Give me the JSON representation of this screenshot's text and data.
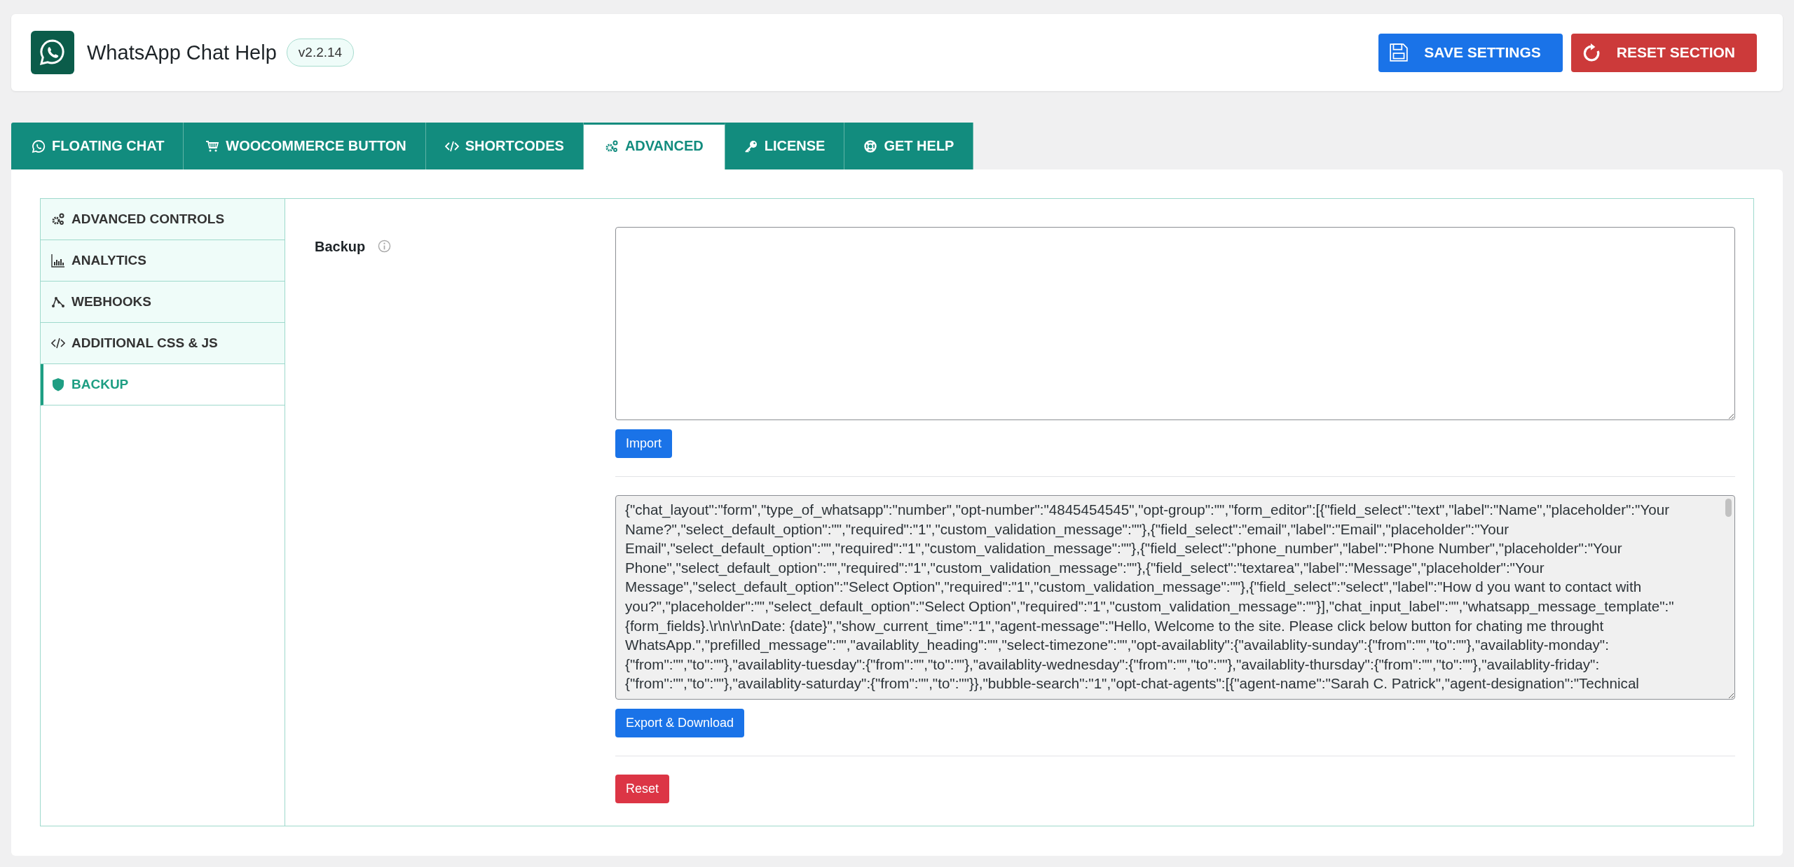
{
  "header": {
    "title": "WhatsApp Chat Help",
    "version": "v2.2.14",
    "buttons": [
      {
        "label": "SAVE SETTINGS",
        "kind": "save"
      },
      {
        "label": "RESET SECTION",
        "kind": "reset"
      }
    ]
  },
  "tabs": [
    {
      "label": "FLOATING CHAT",
      "selected": false
    },
    {
      "label": "WOOCOMMERCE BUTTON",
      "selected": false
    },
    {
      "label": "SHORTCODES",
      "selected": false
    },
    {
      "label": "ADVANCED",
      "selected": true
    },
    {
      "label": "LICENSE",
      "selected": false
    },
    {
      "label": "GET HELP",
      "selected": false
    }
  ],
  "sidebar": {
    "items": [
      {
        "label": "ADVANCED CONTROLS",
        "selected": false
      },
      {
        "label": "ANALYTICS",
        "selected": false
      },
      {
        "label": "WEBHOOKS",
        "selected": false
      },
      {
        "label": "ADDITIONAL CSS & JS",
        "selected": false
      },
      {
        "label": "BACKUP",
        "selected": true
      }
    ]
  },
  "backup": {
    "label": "Backup",
    "import_button": "Import",
    "export_lines": [
      "{\"chat_layout\":\"form\",\"type_of_whatsapp\":\"number\",\"opt-number\":\"4845454545\",\"opt-group\":\"\",\"form_editor\":[{\"field_select\":\"text\",\"label\":\"Name\",\"placeholder\":\"Your",
      "Name?\",\"select_default_option\":\"\",\"required\":\"1\",\"custom_validation_message\":\"\"},{\"field_select\":\"email\",\"label\":\"Email\",\"placeholder\":\"Your",
      "Email\",\"select_default_option\":\"\",\"required\":\"1\",\"custom_validation_message\":\"\"},{\"field_select\":\"phone_number\",\"label\":\"Phone Number\",\"placeholder\":\"Your",
      "Phone\",\"select_default_option\":\"\",\"required\":\"1\",\"custom_validation_message\":\"\"},{\"field_select\":\"textarea\",\"label\":\"Message\",\"placeholder\":\"Your",
      "Message\",\"select_default_option\":\"Select Option\",\"required\":\"1\",\"custom_validation_message\":\"\"},{\"field_select\":\"select\",\"label\":\"How d you want to contact with",
      "you?\",\"placeholder\":\"\",\"select_default_option\":\"Select Option\",\"required\":\"1\",\"custom_validation_message\":\"\"}],\"chat_input_label\":\"\",\"whatsapp_message_template\":\"",
      "{form_fields}.\\r\\n\\r\\nDate: {date}\",\"show_current_time\":\"1\",\"agent-message\":\"Hello, Welcome to the site. Please click below button for chating me throught",
      "WhatsApp.\",\"prefilled_message\":\"\",\"availablity_heading\":\"\",\"select-timezone\":\"\",\"opt-availablity\":{\"availablity-sunday\":{\"from\":\"\",\"to\":\"\"},\"availablity-monday\":",
      "{\"from\":\"\",\"to\":\"\"},\"availablity-tuesday\":{\"from\":\"\",\"to\":\"\"},\"availablity-wednesday\":{\"from\":\"\",\"to\":\"\"},\"availablity-thursday\":{\"from\":\"\",\"to\":\"\"},\"availablity-friday\":",
      "{\"from\":\"\",\"to\":\"\"},\"availablity-saturday\":{\"from\":\"\",\"to\":\"\"}},\"bubble-search\":\"1\",\"opt-chat-agents\":[{\"agent-name\":\"Sarah C. Patrick\",\"agent-designation\":\"Technical"
    ],
    "export_button": "Export & Download",
    "reset_button": "Reset"
  }
}
